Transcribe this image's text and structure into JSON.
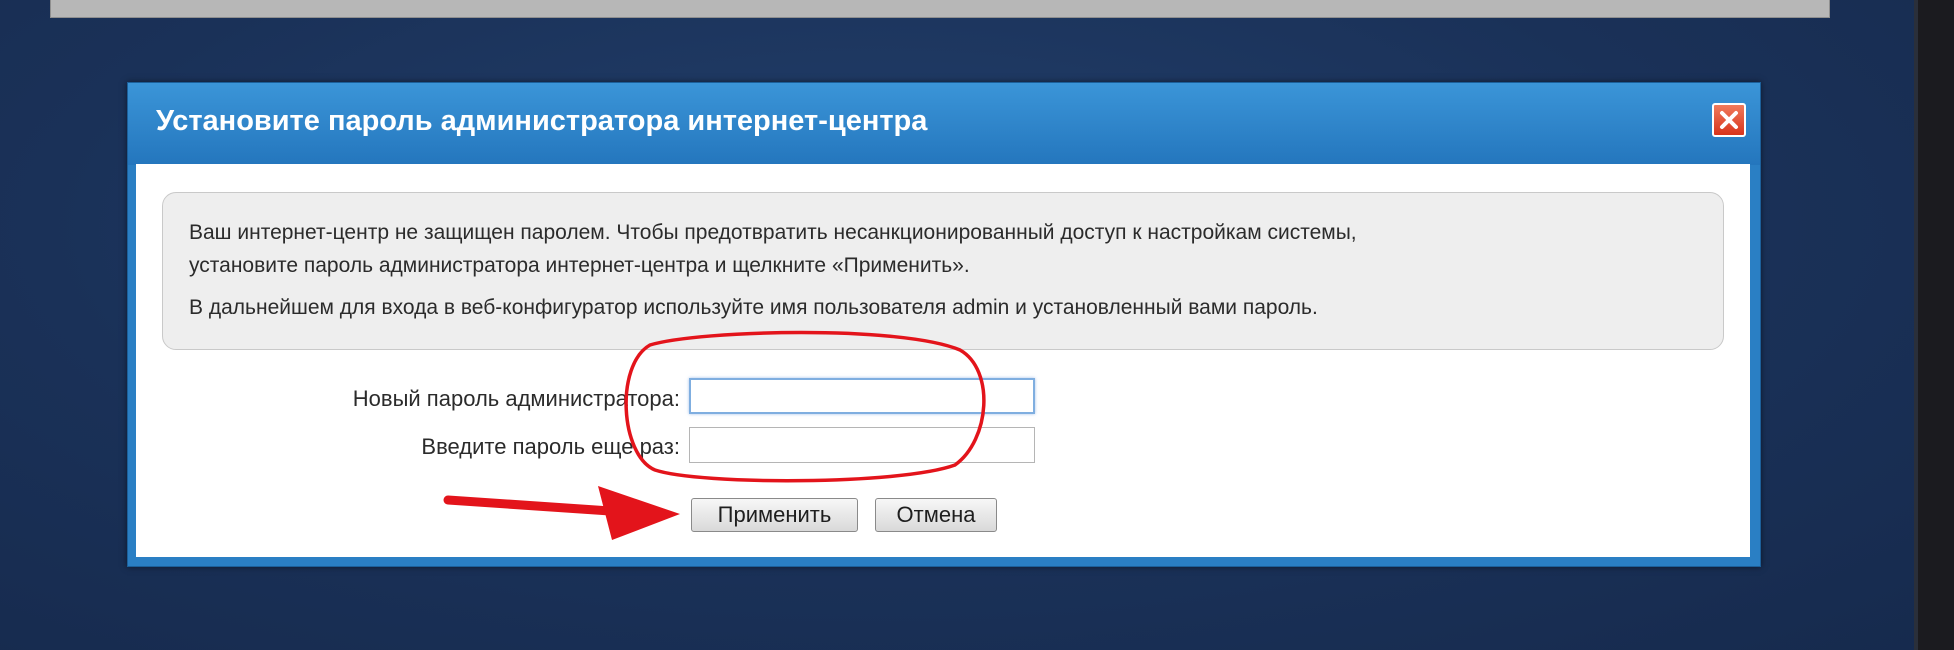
{
  "dialog": {
    "title": "Установите пароль администратора интернет-центра",
    "info": {
      "line1": "Ваш интернет-центр не защищен паролем. Чтобы предотвратить несанкционированный доступ к настройкам системы,",
      "line2": "установите пароль администратора интернет-центра и щелкните «Применить».",
      "line3": "В дальнейшем для входа в веб-конфигуратор используйте имя пользователя admin и установленный вами пароль."
    },
    "form": {
      "new_password_label": "Новый пароль администратора:",
      "new_password_value": "",
      "confirm_password_label": "Введите пароль еще раз:",
      "confirm_password_value": ""
    },
    "buttons": {
      "apply_label": "Применить",
      "cancel_label": "Отмена"
    }
  },
  "colors": {
    "titlebar": "#2a7fc4",
    "background": "#1b3157",
    "annotation_red": "#e3141b"
  },
  "icons": {
    "close": "close-icon",
    "annotation_arrow": "arrow-right-icon",
    "annotation_circle": "highlight-circle"
  }
}
